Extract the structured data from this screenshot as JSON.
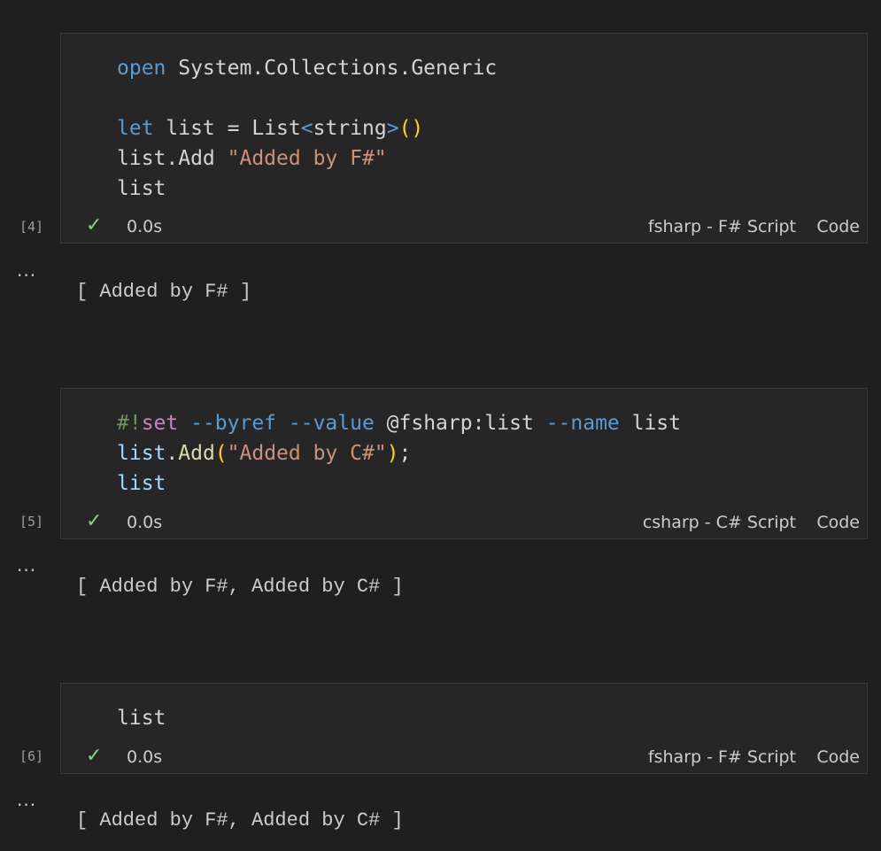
{
  "cells": [
    {
      "execution_count": "[4]",
      "code_lines": [
        [
          {
            "t": "open",
            "c": "kw"
          },
          {
            "t": " System.Collections.Generic",
            "c": "ns"
          }
        ],
        [],
        [
          {
            "t": "let",
            "c": "kw"
          },
          {
            "t": " list ",
            "c": "plain"
          },
          {
            "t": "=",
            "c": "op"
          },
          {
            "t": " List",
            "c": "ty"
          },
          {
            "t": "<",
            "c": "tparen"
          },
          {
            "t": "string",
            "c": "ty"
          },
          {
            "t": ">",
            "c": "tparen"
          },
          {
            "t": "()",
            "c": "br"
          }
        ],
        [
          {
            "t": "list",
            "c": "plain"
          },
          {
            "t": ".Add ",
            "c": "plain"
          },
          {
            "t": "\"Added by F#\"",
            "c": "str"
          }
        ],
        [
          {
            "t": "list",
            "c": "plain"
          }
        ]
      ],
      "status_icon": "check-icon",
      "duration": "0.0s",
      "kernel": "fsharp - F# Script",
      "language": "Code",
      "output_menu": "...",
      "output": "[ Added by F# ]"
    },
    {
      "execution_count": "[5]",
      "code_lines": [
        [
          {
            "t": "#!",
            "c": "mag-hash"
          },
          {
            "t": "set",
            "c": "mag-set"
          },
          {
            "t": " --byref",
            "c": "opt"
          },
          {
            "t": " --value",
            "c": "opt"
          },
          {
            "t": " @fsharp:list",
            "c": "plain"
          },
          {
            "t": " --name",
            "c": "opt"
          },
          {
            "t": " list",
            "c": "plain"
          }
        ],
        [
          {
            "t": "list",
            "c": "id"
          },
          {
            "t": ".",
            "c": "plain"
          },
          {
            "t": "Add",
            "c": "fn"
          },
          {
            "t": "(",
            "c": "br"
          },
          {
            "t": "\"Added by C#\"",
            "c": "str"
          },
          {
            "t": ")",
            "c": "br"
          },
          {
            "t": ";",
            "c": "plain"
          }
        ],
        [
          {
            "t": "list",
            "c": "id"
          }
        ]
      ],
      "status_icon": "check-icon",
      "duration": "0.0s",
      "kernel": "csharp - C# Script",
      "language": "Code",
      "output_menu": "...",
      "output": "[ Added by F#, Added by C# ]"
    },
    {
      "execution_count": "[6]",
      "code_lines": [
        [
          {
            "t": "list",
            "c": "plain"
          }
        ]
      ],
      "status_icon": "check-icon",
      "duration": "0.0s",
      "kernel": "fsharp - F# Script",
      "language": "Code",
      "output_menu": "...",
      "output": "[ Added by F#, Added by C# ]"
    }
  ]
}
